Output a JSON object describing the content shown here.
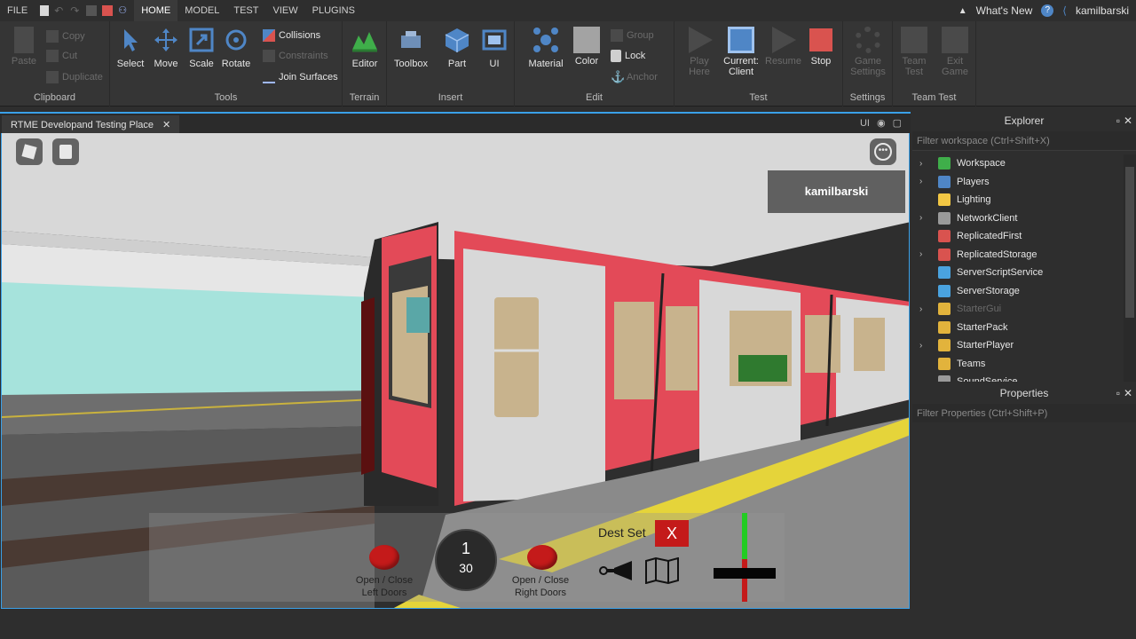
{
  "menubar": {
    "file": "FILE",
    "tabs": [
      "HOME",
      "MODEL",
      "TEST",
      "VIEW",
      "PLUGINS"
    ],
    "active_tab": "HOME",
    "whats_new": "What's New",
    "username": "kamilbarski"
  },
  "ribbon": {
    "clipboard": {
      "label": "Clipboard",
      "paste": "Paste",
      "copy": "Copy",
      "cut": "Cut",
      "duplicate": "Duplicate"
    },
    "tools": {
      "label": "Tools",
      "select": "Select",
      "move": "Move",
      "scale": "Scale",
      "rotate": "Rotate",
      "collisions": "Collisions",
      "constraints": "Constraints",
      "join_surfaces": "Join Surfaces"
    },
    "terrain": {
      "label": "Terrain",
      "editor": "Editor"
    },
    "insert": {
      "label": "Insert",
      "toolbox": "Toolbox",
      "part": "Part",
      "ui": "UI"
    },
    "edit": {
      "label": "Edit",
      "material": "Material",
      "color": "Color",
      "group": "Group",
      "lock": "Lock",
      "anchor": "Anchor"
    },
    "test": {
      "label": "Test",
      "play_here_1": "Play",
      "play_here_2": "Here",
      "current_1": "Current:",
      "current_2": "Client",
      "resume": "Resume",
      "stop": "Stop"
    },
    "settings": {
      "label": "Settings",
      "game_1": "Game",
      "game_2": "Settings"
    },
    "team_test": {
      "label": "Team Test",
      "team_1": "Team",
      "team_2": "Test",
      "exit_1": "Exit",
      "exit_2": "Game"
    }
  },
  "viewport": {
    "tab_title": "RTME Developand Testing Place",
    "ui_toggle": "UI",
    "player_name": "kamilbarski"
  },
  "hud": {
    "left_doors_1": "Open / Close",
    "left_doors_2": "Left Doors",
    "right_doors_1": "Open / Close",
    "right_doors_2": "Right Doors",
    "dial_top": "1",
    "dial_bottom": "30",
    "dest_label": "Dest Set",
    "dest_close": "X"
  },
  "explorer": {
    "title": "Explorer",
    "filter": "Filter workspace (Ctrl+Shift+X)",
    "items": [
      {
        "label": "Workspace",
        "expandable": true,
        "color": "#3fae4a"
      },
      {
        "label": "Players",
        "expandable": true,
        "color": "#4f86c6"
      },
      {
        "label": "Lighting",
        "expandable": false,
        "color": "#f2c744"
      },
      {
        "label": "NetworkClient",
        "expandable": true,
        "color": "#9a9a9a"
      },
      {
        "label": "ReplicatedFirst",
        "expandable": false,
        "color": "#d9534f"
      },
      {
        "label": "ReplicatedStorage",
        "expandable": true,
        "color": "#d9534f"
      },
      {
        "label": "ServerScriptService",
        "expandable": false,
        "color": "#4aa3df"
      },
      {
        "label": "ServerStorage",
        "expandable": false,
        "color": "#4aa3df"
      },
      {
        "label": "StarterGui",
        "expandable": true,
        "color": "#e2b33c",
        "dim": true
      },
      {
        "label": "StarterPack",
        "expandable": false,
        "color": "#e2b33c"
      },
      {
        "label": "StarterPlayer",
        "expandable": true,
        "color": "#e2b33c"
      },
      {
        "label": "Teams",
        "expandable": false,
        "color": "#e2b33c"
      },
      {
        "label": "SoundService",
        "expandable": false,
        "color": "#9a9a9a"
      }
    ]
  },
  "properties": {
    "title": "Properties",
    "filter": "Filter Properties (Ctrl+Shift+P)"
  }
}
